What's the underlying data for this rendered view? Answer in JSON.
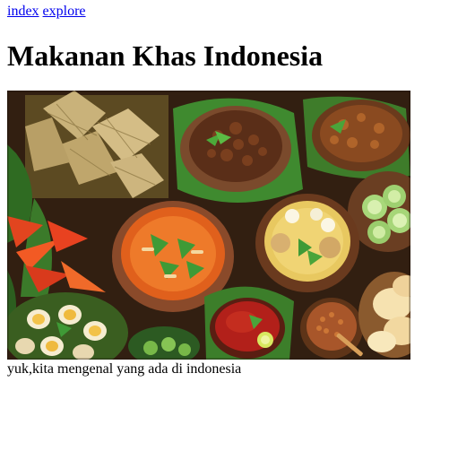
{
  "nav": {
    "links": [
      {
        "label": "index"
      },
      {
        "label": "explore"
      }
    ]
  },
  "page": {
    "title": "Makanan Khas Indonesia",
    "caption": "yuk,kita mengenal yang ada di indonesia"
  },
  "colors": {
    "link": "#0000ee",
    "text": "#000000",
    "background": "#ffffff"
  },
  "image": {
    "semantic": "indonesian-food-spread-photo"
  }
}
